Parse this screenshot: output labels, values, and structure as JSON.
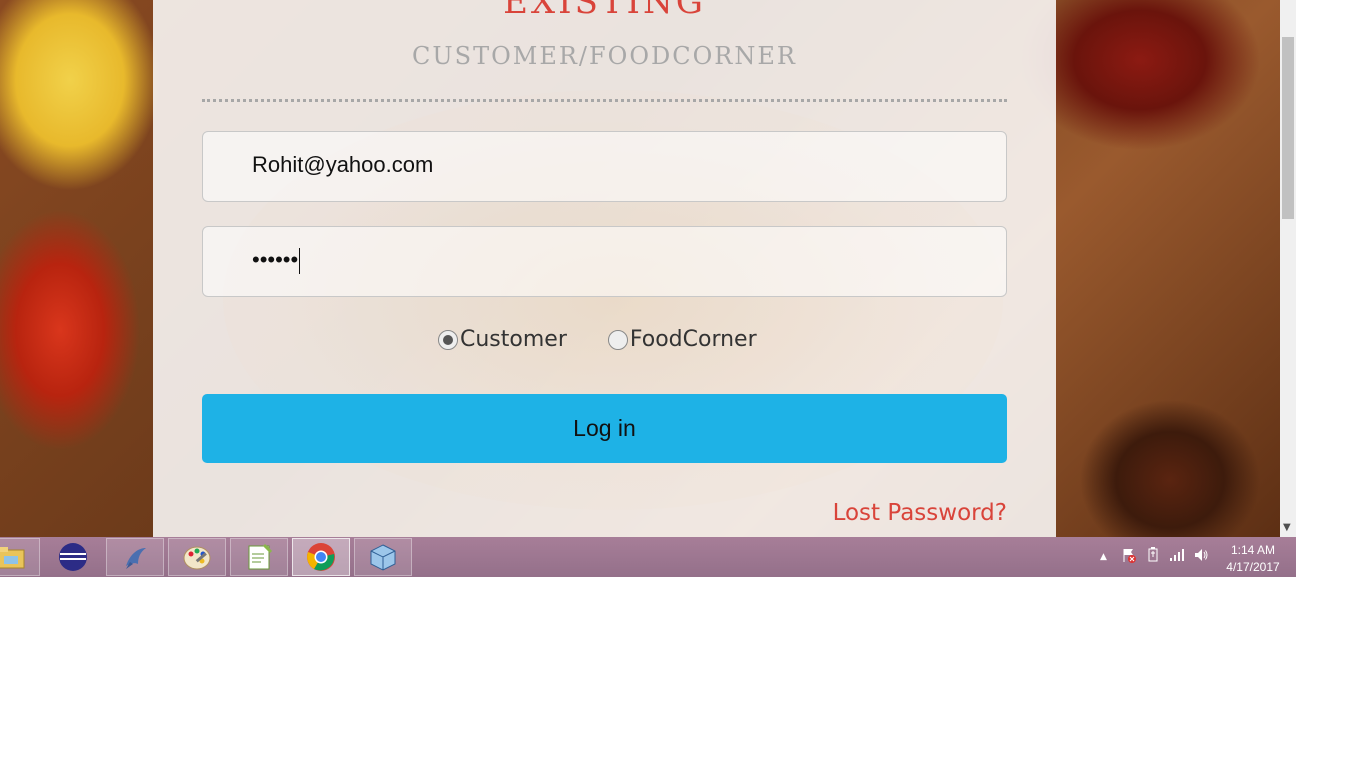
{
  "form": {
    "heading_main": "EXISTING",
    "heading_sub": "CUSTOMER/FOODCORNER",
    "email_value": "Rohit@yahoo.com",
    "password_value": "••••••",
    "radio_customer": "Customer",
    "radio_foodcorner": "FoodCorner",
    "selected_radio": "Customer",
    "login_label": "Log in",
    "lost_password": "Lost Password?"
  },
  "taskbar": {
    "apps": [
      "file-explorer-icon",
      "eclipse-icon",
      "dolphin-icon",
      "paint-icon",
      "notepad-plus-icon",
      "chrome-icon",
      "virtualbox-icon"
    ],
    "active_app": "chrome-icon",
    "clock_time": "1:14 AM",
    "clock_date": "4/17/2017"
  },
  "colors": {
    "accent_red": "#d9443a",
    "login_button": "#1eb2e6",
    "taskbar": "#a77e98"
  }
}
